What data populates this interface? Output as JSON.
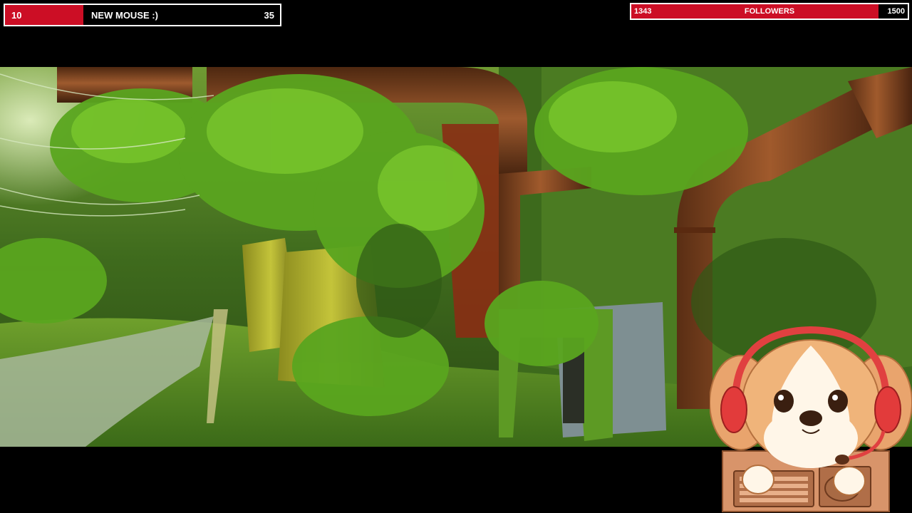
{
  "goals": {
    "mouse": {
      "current": "10",
      "label": "NEW MOUSE :)",
      "target": "35",
      "progress": 0.286
    },
    "followers": {
      "current": "1343",
      "label": "FOLLOWERS",
      "target": "1500",
      "progress": 0.895
    }
  },
  "colors": {
    "accent": "#cc0e25",
    "bar_border": "#ffffff",
    "background": "#000000"
  },
  "scene": {
    "icon": "overgrown-pipes-gameplay"
  },
  "mascot": {
    "icon": "dog-with-headset-at-keyboard"
  }
}
